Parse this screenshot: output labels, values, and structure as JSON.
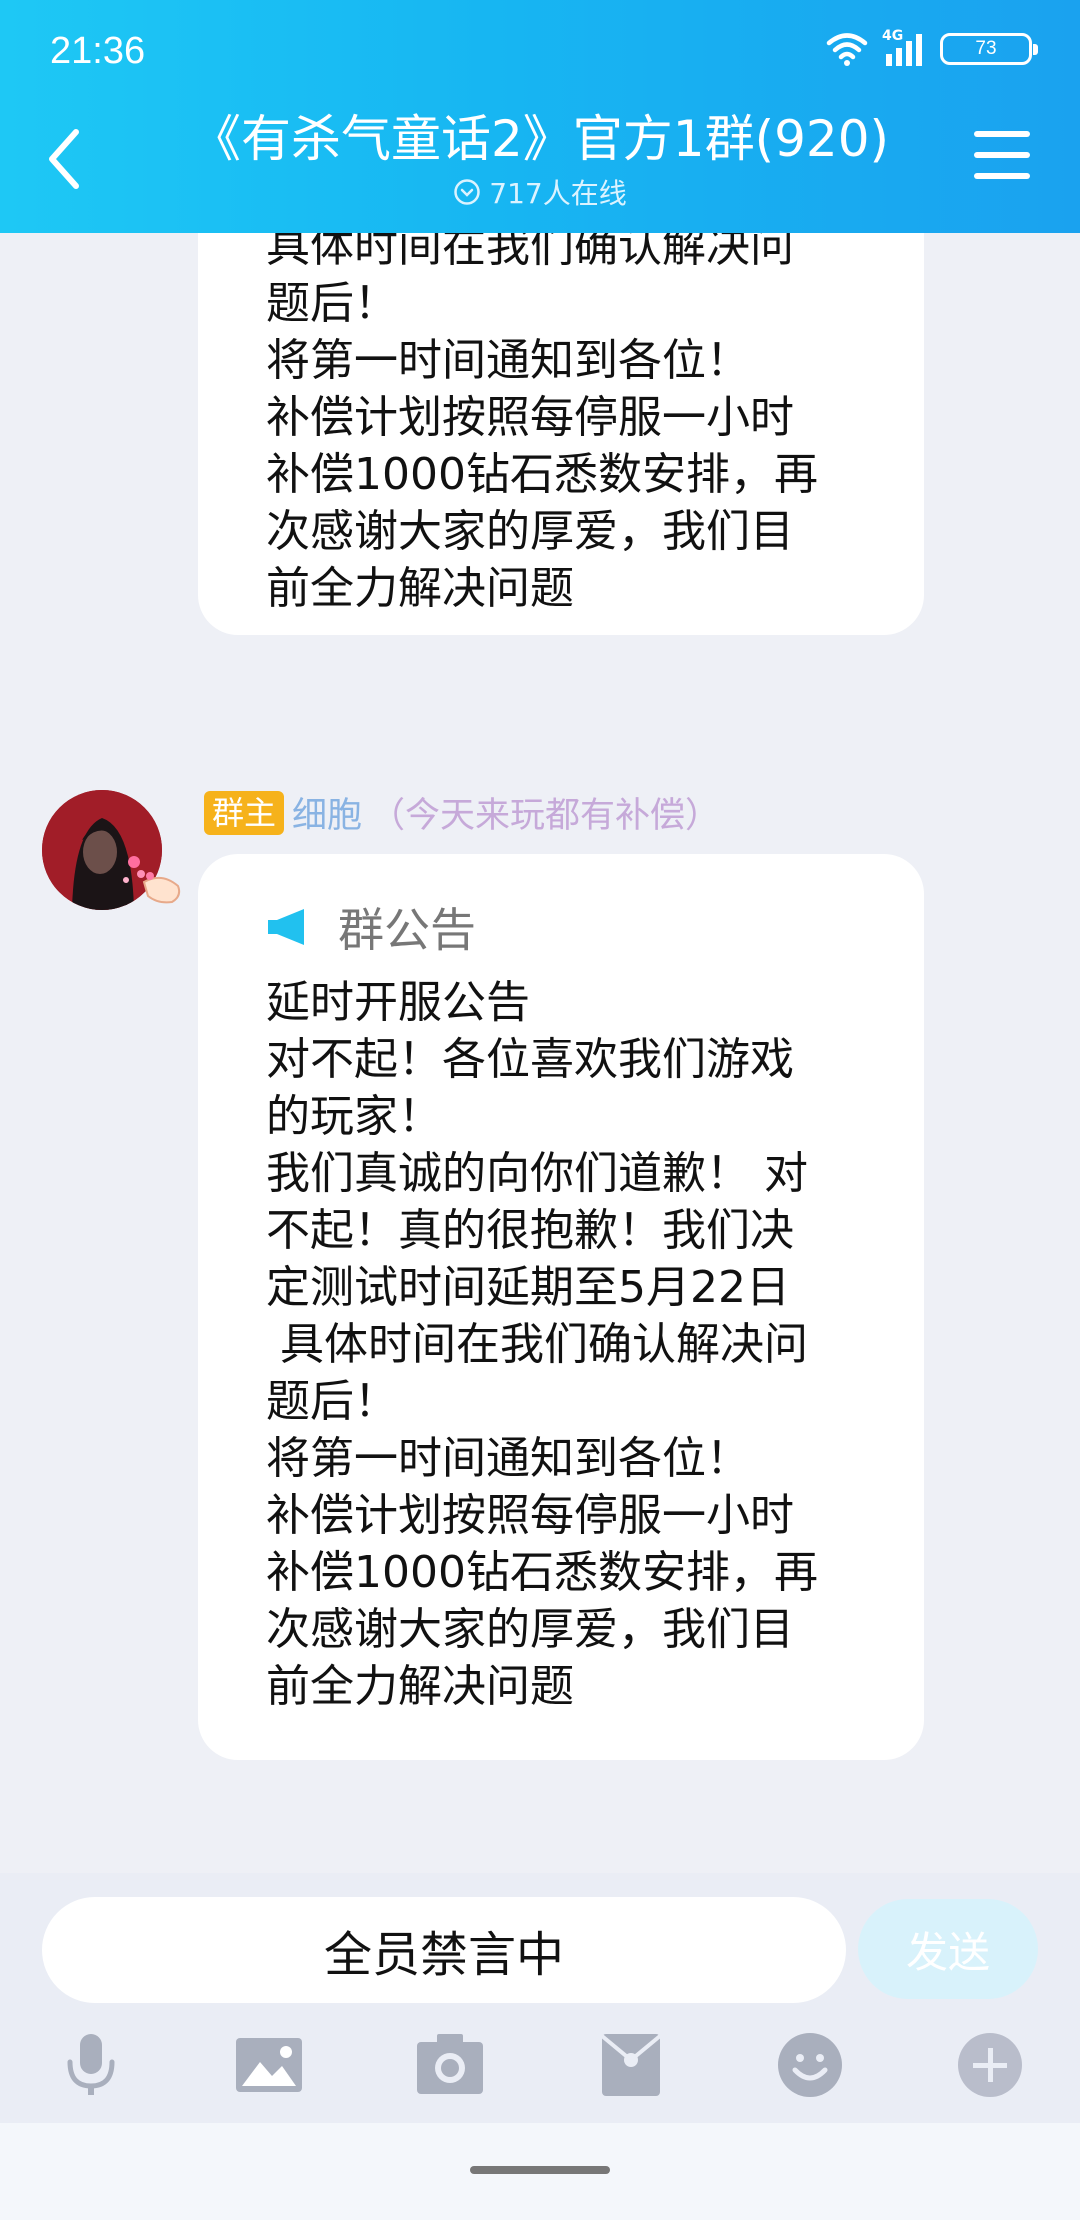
{
  "status_bar": {
    "time": "21:36",
    "network": "4G",
    "battery": "73"
  },
  "header": {
    "title": "《有杀气童话2》官方1群(920)",
    "online": "717人在线"
  },
  "messages": {
    "top_partial": "具体时间在我们确认解决问\n题后！\n将第一时间通知到各位！\n补偿计划按照每停服一小时\n补偿1000钻石悉数安排，再\n次感谢大家的厚爱，我们目\n前全力解决问题",
    "sender": {
      "badge": "群主",
      "name": "细胞",
      "note": "（今天来玩都有补偿）"
    },
    "notice": {
      "label": "群公告",
      "body": "延时开服公告\n对不起！各位喜欢我们游戏\n的玩家！\n我们真诚的向你们道歉！ 对\n不起！真的很抱歉！我们决\n定测试时间延期至5月22日\n 具体时间在我们确认解决问\n题后！\n将第一时间通知到各位！\n补偿计划按照每停服一小时\n补偿1000钻石悉数安排，再\n次感谢大家的厚爱，我们目\n前全力解决问题"
    }
  },
  "input": {
    "muted_text": "全员禁言中",
    "send_label": "发送"
  },
  "toolbar_icons": [
    "microphone-icon",
    "image-icon",
    "camera-icon",
    "red-packet-icon",
    "emoji-icon",
    "plus-icon"
  ],
  "colors": {
    "header": "#1aa9f0",
    "owner_badge": "#f6b21b",
    "background": "#eef0f6"
  }
}
